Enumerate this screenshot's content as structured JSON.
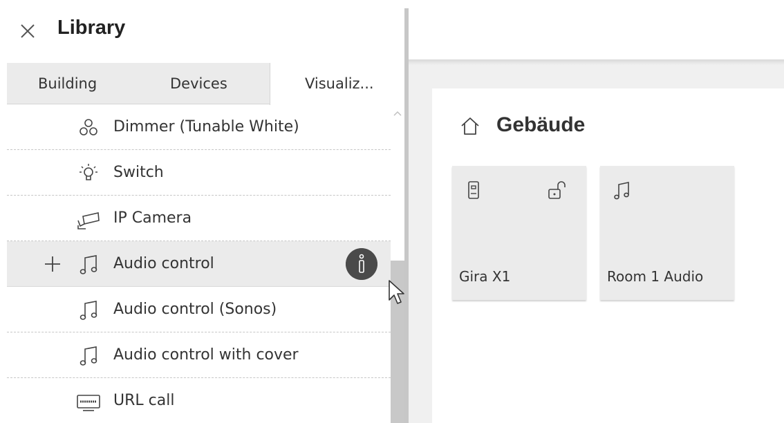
{
  "library": {
    "title": "Library",
    "close_icon": "close-icon",
    "tabs": [
      {
        "label": "Building"
      },
      {
        "label": "Devices"
      },
      {
        "label": "Visualiz..."
      }
    ],
    "active_tab": "Visualiz...",
    "items": [
      {
        "label": "Dimmer (Tunable White)",
        "icon": "color-circles-icon"
      },
      {
        "label": "Switch",
        "icon": "light-bulb-icon"
      },
      {
        "label": "IP Camera",
        "icon": "camera-icon"
      },
      {
        "label": "Audio control",
        "icon": "music-note-icon",
        "selected": true
      },
      {
        "label": "Audio control (Sonos)",
        "icon": "music-note-icon"
      },
      {
        "label": "Audio control with cover",
        "icon": "music-note-icon"
      },
      {
        "label": "URL call",
        "icon": "www-icon"
      }
    ]
  },
  "canvas": {
    "title": "Gebäude",
    "title_icon": "home-icon",
    "tiles": [
      {
        "label": "Gira X1",
        "icons": [
          "device-icon",
          "lock-open-icon"
        ]
      },
      {
        "label": "Room 1 Audio",
        "icons": [
          "music-note-icon"
        ]
      }
    ]
  },
  "colors": {
    "info_badge": "#4a4a4a",
    "selected_row": "#ebebeb",
    "tile_bg": "#ebebeb",
    "workspace_bg": "#f0f0f0"
  }
}
